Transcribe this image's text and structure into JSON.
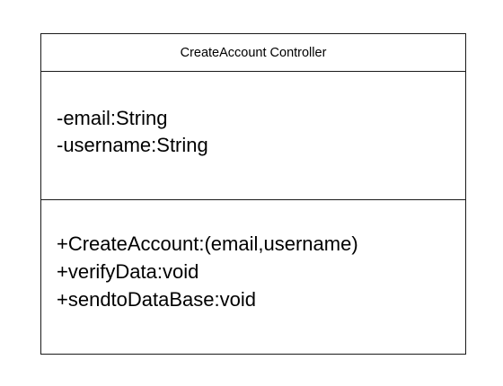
{
  "class": {
    "name": "CreateAccount Controller",
    "attributes": [
      "-email:String",
      "-username:String"
    ],
    "methods": [
      "+CreateAccount:(email,username)",
      "+verifyData:void",
      "+sendtoDataBase:void"
    ]
  }
}
